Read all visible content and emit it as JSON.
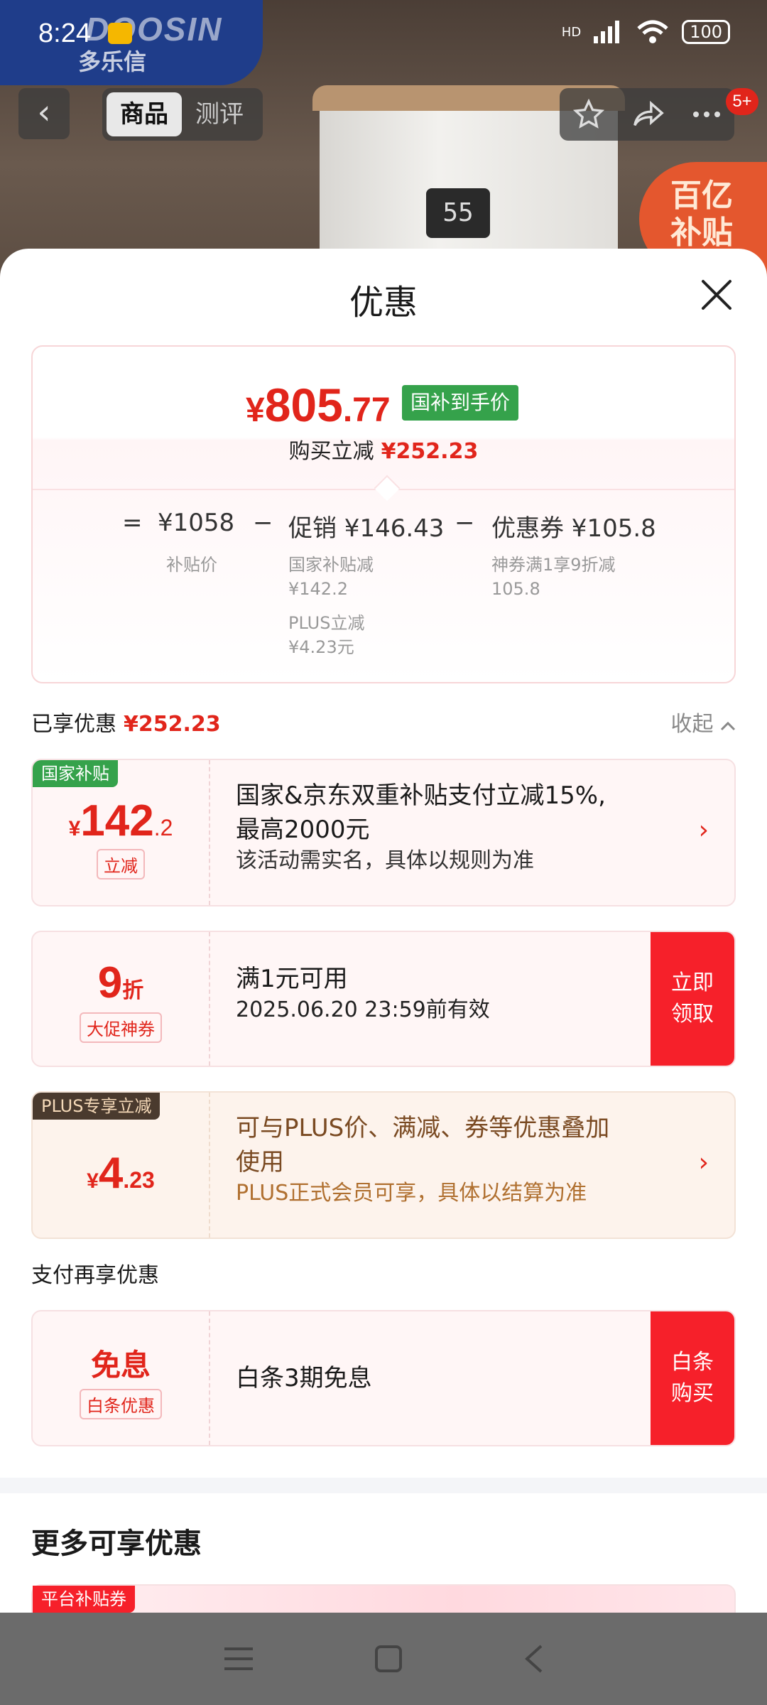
{
  "status_bar": {
    "time": "8:24",
    "network": "HD",
    "battery": "100"
  },
  "background": {
    "brand_en": "DOOSIN",
    "brand_cn": "多乐信",
    "display_reading": "55",
    "badge_line1": "百亿",
    "badge_line2": "补贴"
  },
  "top_nav": {
    "back_icon": "‹",
    "tabs": [
      {
        "label": "商品"
      },
      {
        "label": "测评"
      }
    ],
    "message_badge": "5+"
  },
  "sheet": {
    "title": "优惠",
    "summary": {
      "currency": "¥",
      "price_int": "805",
      "price_dec": ".77",
      "price_tag": "国补到手价",
      "reduce_label": "购买立减",
      "reduce_amount": "¥252.23",
      "eq": "=",
      "base_price": "¥1058",
      "base_label": "补贴价",
      "minus1": "−",
      "promo": "促销 ¥146.43",
      "promo_detail1_line1": "国家补贴减",
      "promo_detail1_line2": "¥142.2",
      "promo_detail2_line1": "PLUS立减",
      "promo_detail2_line2": "¥4.23元",
      "minus2": "−",
      "coupon": "优惠券 ¥105.8",
      "coupon_detail_line1": "神券满1享9折减",
      "coupon_detail_line2": "105.8"
    },
    "enjoyed_label": "已享优惠",
    "enjoyed_amount": "¥252.23",
    "collapse_label": "收起",
    "offers": [
      {
        "tag": "国家补贴",
        "tag_color": "#35a24b",
        "currency": "¥",
        "amount_int": "142",
        "amount_dec": ".2",
        "amount_note": "立减",
        "title_line1": "国家&京东双重补贴支付立减15%,",
        "title_line2": "最高2000元",
        "subtitle": "该活动需实名，具体以规则为准"
      },
      {
        "amount_int": "9",
        "amount_unit": "折",
        "amount_note": "大促神券",
        "title": "满1元可用",
        "subtitle": "2025.06.20 23:59前有效",
        "cta_line1": "立即",
        "cta_line2": "领取"
      },
      {
        "tag": "PLUS专享立减",
        "tag_color": "#4a3a2e",
        "currency": "¥",
        "amount_int": "4",
        "amount_dec": ".23",
        "title_line1": "可与PLUS价、满减、券等优惠叠加",
        "title_line2": "使用",
        "subtitle": "PLUS正式会员可享，具体以结算为准"
      }
    ],
    "pay_section_label": "支付再享优惠",
    "pay_offer": {
      "amount": "免息",
      "amount_note": "白条优惠",
      "title": "白条3期免息",
      "cta_line1": "白条",
      "cta_line2": "购买"
    },
    "more_title": "更多可享优惠",
    "more_tag": "平台补贴券"
  },
  "colors": {
    "accent_red": "#e1251b",
    "cta_red": "#f6202a",
    "gov_green": "#35a24b",
    "plus_brown": "#4a3a2e"
  }
}
